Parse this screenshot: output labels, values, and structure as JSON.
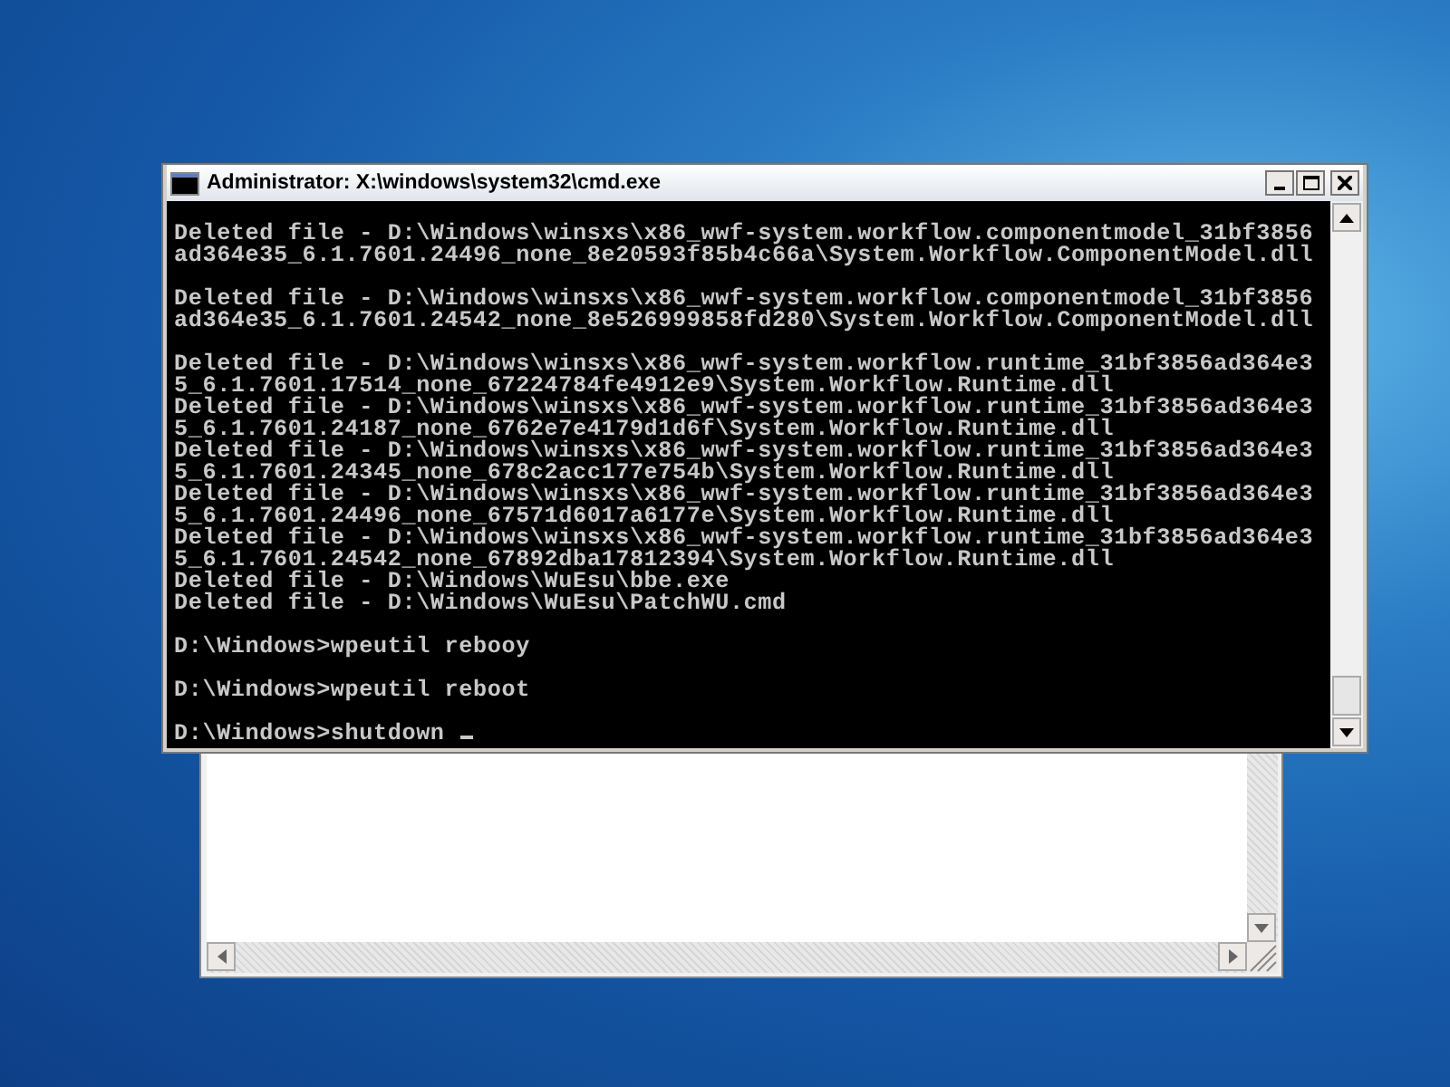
{
  "console_window": {
    "title": "Administrator: X:\\windows\\system32\\cmd.exe",
    "blocks": [
      {
        "lines": [
          "Deleted file - D:\\Windows\\winsxs\\x86_wwf-system.workflow.componentmodel_31bf3856",
          "ad364e35_6.1.7601.24496_none_8e20593f85b4c66a\\System.Workflow.ComponentModel.dll"
        ]
      },
      {
        "lines": [
          "Deleted file - D:\\Windows\\winsxs\\x86_wwf-system.workflow.componentmodel_31bf3856",
          "ad364e35_6.1.7601.24542_none_8e526999858fd280\\System.Workflow.ComponentModel.dll"
        ]
      },
      {
        "lines": [
          "Deleted file - D:\\Windows\\winsxs\\x86_wwf-system.workflow.runtime_31bf3856ad364e3",
          "5_6.1.7601.17514_none_67224784fe4912e9\\System.Workflow.Runtime.dll",
          "Deleted file - D:\\Windows\\winsxs\\x86_wwf-system.workflow.runtime_31bf3856ad364e3",
          "5_6.1.7601.24187_none_6762e7e4179d1d6f\\System.Workflow.Runtime.dll",
          "Deleted file - D:\\Windows\\winsxs\\x86_wwf-system.workflow.runtime_31bf3856ad364e3",
          "5_6.1.7601.24345_none_678c2acc177e754b\\System.Workflow.Runtime.dll",
          "Deleted file - D:\\Windows\\winsxs\\x86_wwf-system.workflow.runtime_31bf3856ad364e3",
          "5_6.1.7601.24496_none_67571d6017a6177e\\System.Workflow.Runtime.dll",
          "Deleted file - D:\\Windows\\winsxs\\x86_wwf-system.workflow.runtime_31bf3856ad364e3",
          "5_6.1.7601.24542_none_67892dba17812394\\System.Workflow.Runtime.dll",
          "Deleted file - D:\\Windows\\WuEsu\\bbe.exe",
          "Deleted file - D:\\Windows\\WuEsu\\PatchWU.cmd"
        ]
      },
      {
        "lines": [
          "D:\\Windows>wpeutil rebooy"
        ]
      },
      {
        "lines": [
          "D:\\Windows>wpeutil reboot"
        ]
      },
      {
        "lines": [
          "D:\\Windows>shutdown "
        ]
      }
    ]
  }
}
